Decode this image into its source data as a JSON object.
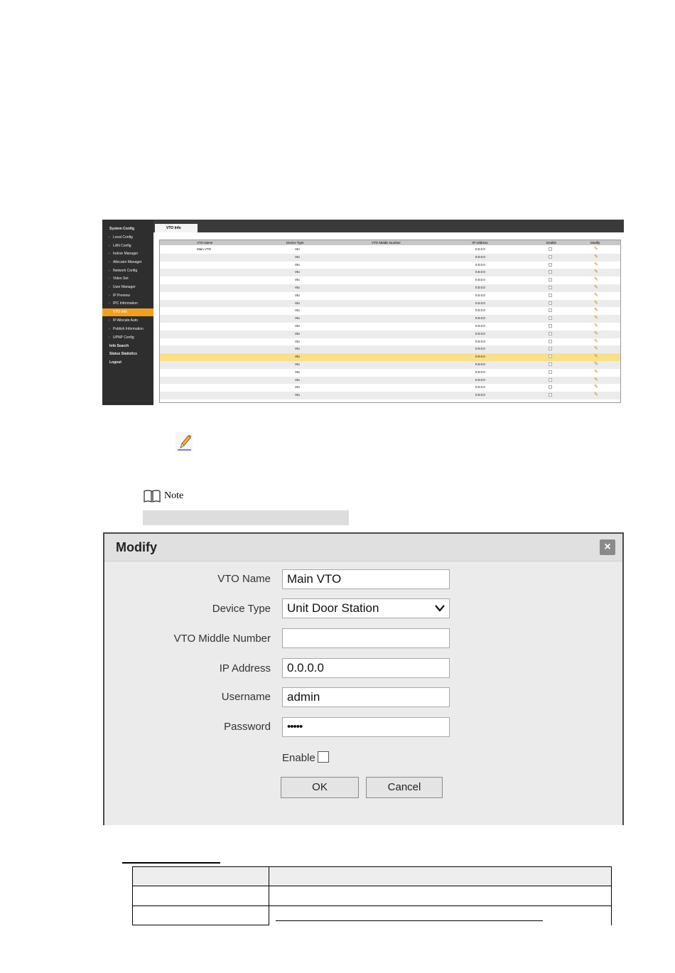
{
  "screenshot": {
    "sidebar": [
      {
        "label": "System Config",
        "level": "top"
      },
      {
        "label": "Local Config",
        "level": "sub"
      },
      {
        "label": "LAN Config",
        "level": "sub"
      },
      {
        "label": "Indoor Manager",
        "level": "sub"
      },
      {
        "label": "Allocator Manager",
        "level": "sub"
      },
      {
        "label": "Network Config",
        "level": "sub"
      },
      {
        "label": "Video Set",
        "level": "sub"
      },
      {
        "label": "User Manager",
        "level": "sub"
      },
      {
        "label": "IP Preview",
        "level": "sub"
      },
      {
        "label": "IPC Information",
        "level": "sub"
      },
      {
        "label": "VTO Info",
        "level": "sub",
        "active": true
      },
      {
        "label": "IP Allocate Auto",
        "level": "sub"
      },
      {
        "label": "Publish Information",
        "level": "sub"
      },
      {
        "label": "UPNP Config",
        "level": "sub"
      },
      {
        "label": "Info Search",
        "level": "top"
      },
      {
        "label": "Status Statistics",
        "level": "top"
      },
      {
        "label": "Logout",
        "level": "top"
      }
    ],
    "tab_label": "VTO Info",
    "table": {
      "headers": [
        "VTO Name",
        "Device Type",
        "VTO Middle Number",
        "IP Address",
        "Enable",
        "Modify"
      ],
      "rows": [
        {
          "name": "Main VTO",
          "type": "Vto",
          "middle": "",
          "ip": "0.0.0.0"
        },
        {
          "name": "",
          "type": "Vto",
          "middle": "",
          "ip": "0.0.0.0"
        },
        {
          "name": "",
          "type": "Vto",
          "middle": "",
          "ip": "0.0.0.0"
        },
        {
          "name": "",
          "type": "Vto",
          "middle": "",
          "ip": "0.0.0.0"
        },
        {
          "name": "",
          "type": "Vto",
          "middle": "",
          "ip": "0.0.0.0"
        },
        {
          "name": "",
          "type": "Vto",
          "middle": "",
          "ip": "0.0.0.0"
        },
        {
          "name": "",
          "type": "Vto",
          "middle": "",
          "ip": "0.0.0.0"
        },
        {
          "name": "",
          "type": "Vto",
          "middle": "",
          "ip": "0.0.0.0"
        },
        {
          "name": "",
          "type": "Vto",
          "middle": "",
          "ip": "0.0.0.0"
        },
        {
          "name": "",
          "type": "Vto",
          "middle": "",
          "ip": "0.0.0.0"
        },
        {
          "name": "",
          "type": "Vto",
          "middle": "",
          "ip": "0.0.0.0"
        },
        {
          "name": "",
          "type": "Vto",
          "middle": "",
          "ip": "0.0.0.0"
        },
        {
          "name": "",
          "type": "Vto",
          "middle": "",
          "ip": "0.0.0.0"
        },
        {
          "name": "",
          "type": "Vto",
          "middle": "",
          "ip": "0.0.0.0"
        },
        {
          "name": "",
          "type": "Vto",
          "middle": "",
          "ip": "0.0.0.0",
          "highlighted": true
        },
        {
          "name": "",
          "type": "Vto",
          "middle": "",
          "ip": "0.0.0.0"
        },
        {
          "name": "",
          "type": "Vto",
          "middle": "",
          "ip": "0.0.0.0"
        },
        {
          "name": "",
          "type": "Vto",
          "middle": "",
          "ip": "0.0.0.0"
        },
        {
          "name": "",
          "type": "Vto",
          "middle": "",
          "ip": "0.0.0.0"
        },
        {
          "name": "",
          "type": "Vto",
          "middle": "",
          "ip": "0.0.0.0"
        }
      ]
    }
  },
  "note": {
    "label": "Note"
  },
  "dialog": {
    "title": "Modify",
    "close_symbol": "×",
    "fields": {
      "vto_name_label": "VTO Name",
      "vto_name_value": "Main VTO",
      "device_type_label": "Device Type",
      "device_type_value": "Unit Door Station",
      "middle_number_label": "VTO Middle Number",
      "middle_number_value": "",
      "ip_label": "IP Address",
      "ip_value": "0.0.0.0",
      "username_label": "Username",
      "username_value": "admin",
      "password_label": "Password",
      "password_value": "•••••"
    },
    "enable_label": "Enable",
    "ok_label": "OK",
    "cancel_label": "Cancel"
  },
  "colors": {
    "active_menu": "#f0a020",
    "highlight_row": "#fbe08a",
    "pencil": "#d08010"
  }
}
